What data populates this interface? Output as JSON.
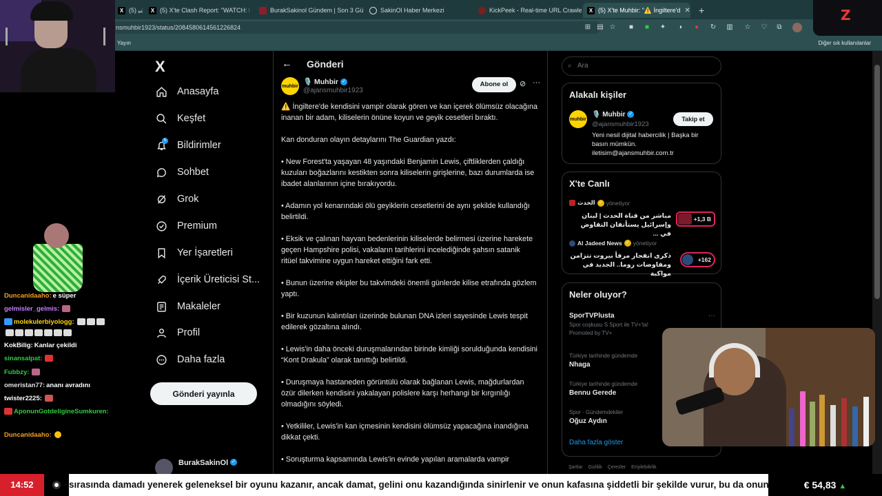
{
  "browser": {
    "tabs": [
      {
        "label": "(5) ﺷﯿ",
        "icon": "x-icon"
      },
      {
        "label": "(5) X'te Clash Report: \"WATCH: Ru",
        "icon": "x-icon"
      },
      {
        "label": "BurakSakinol Gündem | Son 3 Gün",
        "icon": "site-icon"
      },
      {
        "label": "SakinOl Haber Merkezi",
        "icon": "globe-icon"
      },
      {
        "label": "KickPeek - Real-time URL Crawler",
        "icon": "kick-icon"
      },
      {
        "label": "(5) X'te Muhbir: \"⚠️ İngiltere'd",
        "icon": "x-icon"
      }
    ],
    "url": "nsmuhbir1923/status/2084580614561226824",
    "bookmark_left": "Yayın",
    "bookmark_right": "Diğer sık kullanılanlar"
  },
  "nav": {
    "logo": "X",
    "items": [
      {
        "label": "Anasayfa",
        "icon": "home-icon"
      },
      {
        "label": "Keşfet",
        "icon": "search-icon"
      },
      {
        "label": "Bildirimler",
        "icon": "bell-icon"
      },
      {
        "label": "Sohbet",
        "icon": "chat-icon"
      },
      {
        "label": "Grok",
        "icon": "grok-icon"
      },
      {
        "label": "Premium",
        "icon": "premium-icon"
      },
      {
        "label": "Yer İşaretleri",
        "icon": "bookmark-icon"
      },
      {
        "label": "İçerik Üreticisi St...",
        "icon": "rocket-icon"
      },
      {
        "label": "Makaleler",
        "icon": "article-icon"
      },
      {
        "label": "Profil",
        "icon": "person-icon"
      },
      {
        "label": "Daha fazla",
        "icon": "more-circle-icon"
      }
    ],
    "notification_count": "5",
    "post_button": "Gönderi yayınla",
    "account_name": "BurakSakinOl"
  },
  "post": {
    "header_title": "Gönderi",
    "author_name": "🎙️ Muhbir",
    "author_handle": "@ajansmuhbir1923",
    "avatar_text": "muhbir",
    "subscribe_label": "Abone ol",
    "paragraphs": [
      "⚠️ İngiltere'de kendisini vampir olarak gören ve kan içerek ölümsüz olacağına inanan bir adam, kiliselerin önüne koyun ve geyik cesetleri bıraktı.",
      "Kan donduran olayın detaylarını The Guardian yazdı:",
      "• New Forest'ta yaşayan 48 yaşındaki Benjamin Lewis, çiftliklerden çaldığı kuzuları boğazlarını kestikten sonra kiliselerin girişlerine, bazı durumlarda ise ibadet alanlarının içine bırakıyordu.",
      "• Adamın yol kenarındaki ölü geyiklerin cesetlerini de aynı şekilde kullandığı belirtildi.",
      "• Eksik ve çalınan hayvan bedenlerinin kiliselerde belirmesi üzerine harekete geçen Hampshire polisi, vakaların tarihlerini incelediğinde şahsın satanik ritüel takvimine uygun hareket ettiğini fark etti.",
      "• Bunun üzerine ekipler bu takvimdeki önemli günlerde kilise etrafında gözlem yaptı.",
      "• Bir kuzunun kalıntıları üzerinde bulunan DNA izleri sayesinde Lewis tespit edilerek gözaltına alındı.",
      "• Lewis'in daha önceki duruşmalarından birinde kimliği sorulduğunda kendisini “Kont Drakula” olarak tanıttığı belirtildi.",
      "• Duruşmaya hastaneden görüntülü olarak bağlanan Lewis, mağdurlardan özür dilerken kendisini yakalayan polislere karşı herhangi bir kırgınlığı olmadığını söyledi.",
      "• Yetkililer, Lewis'in kan içmesinin kendisini ölümsüz yapacağına inandığına dikkat çekti.",
      "• Soruşturma kapsamında Lewis'in evinde yapılan aramalarda vampir"
    ]
  },
  "right": {
    "search_placeholder": "Ara",
    "related": {
      "title": "Alakalı kişiler",
      "name": "🎙️ Muhbir",
      "handle": "@ajansmuhbir1923",
      "follow_label": "Takip et",
      "bio": "Yeni nesil dijital habercilik | Başka bir basın mümkün. iletisim@ajansmuhbir.com.tr"
    },
    "live": {
      "title": "X'te Canlı",
      "items": [
        {
          "source": "الحدث",
          "role": "yönetiyor",
          "text": "مباشر من قناة الحدث | لبنان وإسرائيل يستأنفان التفاوض في ...",
          "count": "+1,3 B"
        },
        {
          "source": "Al Jadeed News",
          "role": "yönetiyor",
          "text": "ذكرى انفجار مرفأ بيروت تتزامن ومفاوضات روما.. الجديد في مواكبة",
          "count": "+162"
        }
      ]
    },
    "happening": {
      "title": "Neler oluyor?",
      "promo_name": "SporTVPlusta",
      "promo_text": "Spor coşkusu S Sport ile TV+'ta!",
      "promo_by": "Promoted by TV+",
      "trends": [
        {
          "category": "Türkiye tarihinde gündemde",
          "name": "Nhaga"
        },
        {
          "category": "Türkiye tarihinde gündemde",
          "name": "Bennu Gerede"
        },
        {
          "category": "Spor · Gündemdekiler",
          "name": "Oğuz Aydın"
        }
      ],
      "show_more": "Daha fazla göster"
    },
    "footer": "Şartlar Gizlilik Çerezler Erişilebilirlik"
  },
  "chat": {
    "messages": [
      {
        "user": "Duncanidaaho:",
        "text": "e süper",
        "color": "#f4a020"
      },
      {
        "user": "gelmisler_gelmis:",
        "text": "",
        "color": "#c77dff"
      },
      {
        "user": "molekulerbiyologg:",
        "text": "",
        "color": "#ffd60a"
      },
      {
        "user": "",
        "text": "",
        "color": "#ffffff"
      },
      {
        "user": "KokBilig:",
        "text": "Kanlar çekildi",
        "color": "#ffffff"
      },
      {
        "user": "sinansalpat:",
        "text": "",
        "color": "#2ecc40"
      },
      {
        "user": "Fubbzy:",
        "text": "",
        "color": "#2ecc40"
      },
      {
        "user": "omeristan77:",
        "text": "ananı avradını",
        "color": "#e0e0e0"
      },
      {
        "user": "twister2225:",
        "text": "",
        "color": "#ffffff"
      },
      {
        "user": "AponunGotdeligineSumkuren:",
        "text": "",
        "color": "#2ecc40"
      },
      {
        "user": "Duncanidaaho:",
        "text": "",
        "color": "#f4a020"
      }
    ]
  },
  "ticker": {
    "time": "14:52",
    "text": "sırasında damadı yenerek geleneksel bir oyunu kazanır, ancak damat, gelini onu kazandığında sinirlenir ve onun kafasına şiddetli bir şekilde vurur, bu da onun",
    "price": "€ 54,83",
    "price_trend": "▲"
  },
  "colors": {
    "accent": "#1d9bf0",
    "ticker_red": "#d7202b",
    "brand_logo": "#e53935"
  }
}
